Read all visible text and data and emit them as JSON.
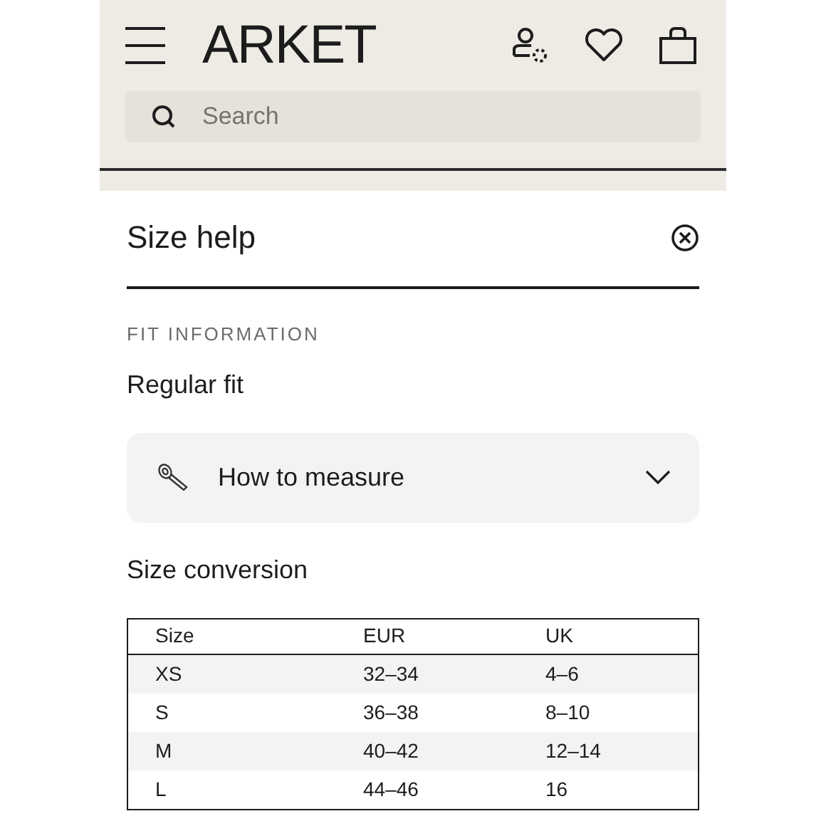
{
  "header": {
    "logo": "ARKET",
    "search": {
      "placeholder": "Search"
    }
  },
  "panel": {
    "title": "Size help",
    "section_label": "FIT INFORMATION",
    "fit": "Regular fit",
    "accordion": {
      "label": "How to measure",
      "expanded": false
    },
    "conversion_title": "Size conversion",
    "table": {
      "columns": [
        "Size",
        "EUR",
        "UK"
      ],
      "rows": [
        [
          "XS",
          "32–34",
          "4–6"
        ],
        [
          "S",
          "36–38",
          "8–10"
        ],
        [
          "M",
          "40–42",
          "12–14"
        ],
        [
          "L",
          "44–46",
          "16"
        ]
      ]
    }
  }
}
